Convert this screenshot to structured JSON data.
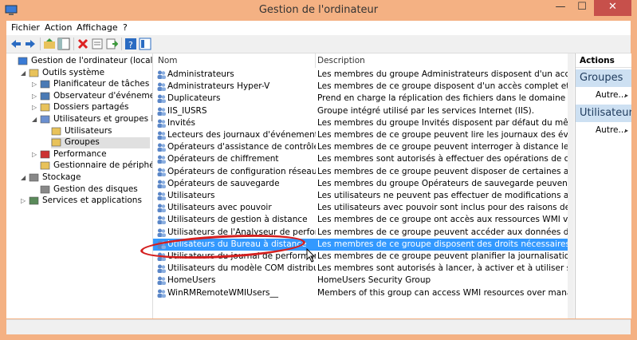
{
  "window": {
    "title": "Gestion de l'ordinateur",
    "minimize": "—",
    "maximize": "☐",
    "close": "✕"
  },
  "menu": [
    "Fichier",
    "Action",
    "Affichage",
    "?"
  ],
  "toolbar": [
    "back-icon",
    "forward-icon",
    "up-icon",
    "show-tree-icon",
    "delete-icon",
    "properties-icon",
    "export-icon",
    "help-icon",
    "console-icon"
  ],
  "tree": [
    {
      "label": "Gestion de l'ordinateur (local)",
      "icon": "computer-icon",
      "indent": 0,
      "arrow": ""
    },
    {
      "label": "Outils système",
      "icon": "tools-icon",
      "indent": 1,
      "arrow": "◢"
    },
    {
      "label": "Planificateur de tâches",
      "icon": "clock-icon",
      "indent": 2,
      "arrow": "▷"
    },
    {
      "label": "Observateur d'événements",
      "icon": "event-viewer-icon",
      "indent": 2,
      "arrow": "▷"
    },
    {
      "label": "Dossiers partagés",
      "icon": "shared-folder-icon",
      "indent": 2,
      "arrow": "▷"
    },
    {
      "label": "Utilisateurs et groupes locaux",
      "icon": "users-icon",
      "indent": 2,
      "arrow": "◢"
    },
    {
      "label": "Utilisateurs",
      "icon": "folder-icon",
      "indent": 3,
      "arrow": ""
    },
    {
      "label": "Groupes",
      "icon": "folder-icon",
      "indent": 3,
      "arrow": "",
      "selected": true
    },
    {
      "label": "Performance",
      "icon": "performance-icon",
      "indent": 2,
      "arrow": "▷"
    },
    {
      "label": "Gestionnaire de périphériques",
      "icon": "device-manager-icon",
      "indent": 2,
      "arrow": ""
    },
    {
      "label": "Stockage",
      "icon": "storage-icon",
      "indent": 1,
      "arrow": "◢"
    },
    {
      "label": "Gestion des disques",
      "icon": "disk-icon",
      "indent": 2,
      "arrow": ""
    },
    {
      "label": "Services et applications",
      "icon": "services-icon",
      "indent": 1,
      "arrow": "▷"
    }
  ],
  "list": {
    "columns": [
      "Nom",
      "Description"
    ],
    "rows": [
      {
        "name": "Administrateurs",
        "desc": "Les membres du groupe Administrateurs disposent d'un accès complet et"
      },
      {
        "name": "Administrateurs Hyper-V",
        "desc": "Les membres de ce groupe disposent d'un accès complet et illimité à tou"
      },
      {
        "name": "Duplicateurs",
        "desc": "Prend en charge la réplication des fichiers dans le domaine"
      },
      {
        "name": "IIS_IUSRS",
        "desc": "Groupe intégré utilisé par les services Internet (IIS)."
      },
      {
        "name": "Invités",
        "desc": "Les membres du groupe Invités disposent par défaut du même accès que"
      },
      {
        "name": "Lecteurs des journaux d'événements",
        "desc": "Les membres de ce groupe peuvent lire les journaux des événements à pa"
      },
      {
        "name": "Opérateurs d'assistance de contrôle d'accès",
        "desc": "Les membres de ce groupe peuvent interroger à distance les attributs d'au"
      },
      {
        "name": "Opérateurs de chiffrement",
        "desc": "Les membres sont autorisés à effectuer des opérations de chiffrement."
      },
      {
        "name": "Opérateurs de configuration réseau",
        "desc": "Les membres de ce groupe peuvent disposer de certaines autorisations d"
      },
      {
        "name": "Opérateurs de sauvegarde",
        "desc": "Les membres du groupe Opérateurs de sauvegarde peuvent passer outre l"
      },
      {
        "name": "Utilisateurs",
        "desc": "Les utilisateurs ne peuvent pas effectuer de modifications accidentelles o"
      },
      {
        "name": "Utilisateurs avec pouvoir",
        "desc": "Les utilisateurs avec pouvoir sont inclus pour des raisons de compatibilit"
      },
      {
        "name": "Utilisateurs de gestion à distance",
        "desc": "Les membres de ce groupe ont accès aux ressources WMI via des protocol"
      },
      {
        "name": "Utilisateurs de l'Analyseur de performances",
        "desc": "Les membres de ce groupe peuvent accéder aux données de compteur de"
      },
      {
        "name": "Utilisateurs du Bureau à distance",
        "desc": "Les membres de ce groupe disposent des droits nécessaires pour ouvrir un",
        "selected": true
      },
      {
        "name": "Utilisateurs du journal de performances",
        "desc": "Les membres de ce groupe peuvent planifier la journalisation des compteu"
      },
      {
        "name": "Utilisateurs du modèle COM distribué",
        "desc": "Les membres sont autorisés à lancer, à activer et à utiliser sur cet ordinate"
      },
      {
        "name": "HomeUsers",
        "desc": "HomeUsers Security Group"
      },
      {
        "name": "WinRMRemoteWMIUsers__",
        "desc": "Members of this group can access WMI resources over management prot"
      }
    ]
  },
  "actions": {
    "title": "Actions",
    "sections": [
      {
        "header": "Groupes",
        "item": "Autre...",
        "arrow": "▸"
      },
      {
        "header": "Utilisateurs du Bureau à distance",
        "item": "Autre...",
        "arrow": "▸"
      }
    ]
  },
  "colors": {
    "titlebar": "#f4b183",
    "selection": "#3399ff",
    "action_header": "#cde0f2",
    "highlight_circle": "#d41f1f",
    "close_button": "#c7504b"
  }
}
